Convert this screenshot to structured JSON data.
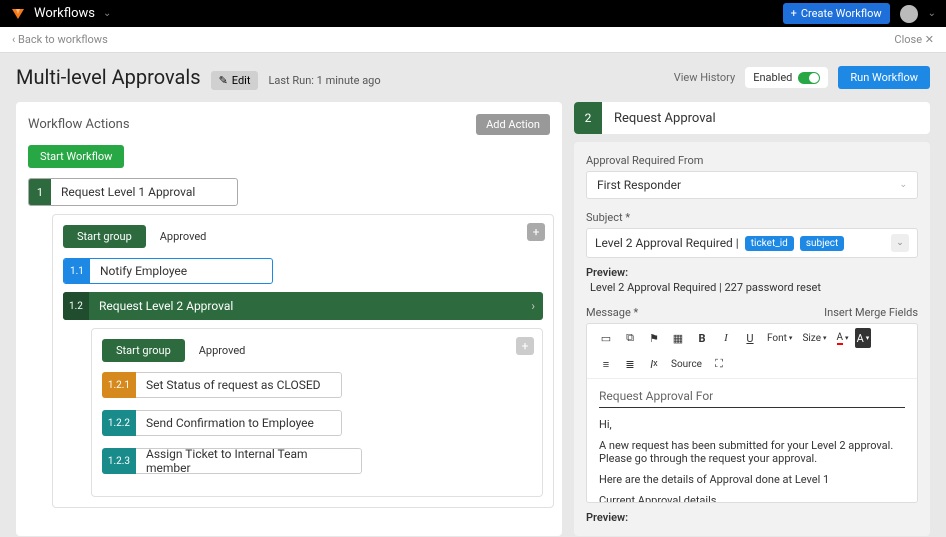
{
  "topbar": {
    "product": "Workflows",
    "create_btn": "Create Workflow"
  },
  "subbar": {
    "back": "Back to workflows",
    "close": "Close"
  },
  "header": {
    "title": "Multi-level Approvals",
    "edit": "Edit",
    "last_run": "Last Run: 1 minute ago",
    "view_history": "View History",
    "enabled": "Enabled",
    "run": "Run Workflow"
  },
  "left": {
    "panel_title": "Workflow Actions",
    "add_action": "Add Action",
    "start": "Start Workflow",
    "step1_num": "1",
    "step1_label": "Request Level 1 Approval",
    "group1_pill": "Start group",
    "group1_status": "Approved",
    "step1_1_num": "1.1",
    "step1_1_label": "Notify Employee",
    "step1_2_num": "1.2",
    "step1_2_label": "Request Level 2 Approval",
    "group2_pill": "Start group",
    "group2_status": "Approved",
    "step1_2_1_num": "1.2.1",
    "step1_2_1_label": "Set Status of request as CLOSED",
    "step1_2_2_num": "1.2.2",
    "step1_2_2_label": "Send Confirmation to Employee",
    "step1_2_3_num": "1.2.3",
    "step1_2_3_label": "Assign Ticket to Internal Team member"
  },
  "right": {
    "num": "2",
    "title": "Request Approval",
    "approval_label": "Approval Required From",
    "approval_value": "First Responder",
    "subject_label": "Subject *",
    "subject_text": "Level 2 Approval Required |",
    "tag_ticket": "ticket_id",
    "tag_subject": "subject",
    "preview_label": "Preview:",
    "preview_text": "Level 2 Approval Required | 227 password reset",
    "message_label": "Message *",
    "insert_merge": "Insert Merge Fields",
    "toolbar": {
      "font": "Font",
      "size": "Size",
      "A": "A",
      "source": "Source"
    },
    "editor": {
      "field_title": "Request Approval For",
      "hi": "Hi,",
      "line1": "A new request has been submitted for your Level 2 approval. Please go through the request your approval.",
      "line2": "Here are the details of Approval done at Level 1",
      "line3": "Current Approval details"
    }
  }
}
